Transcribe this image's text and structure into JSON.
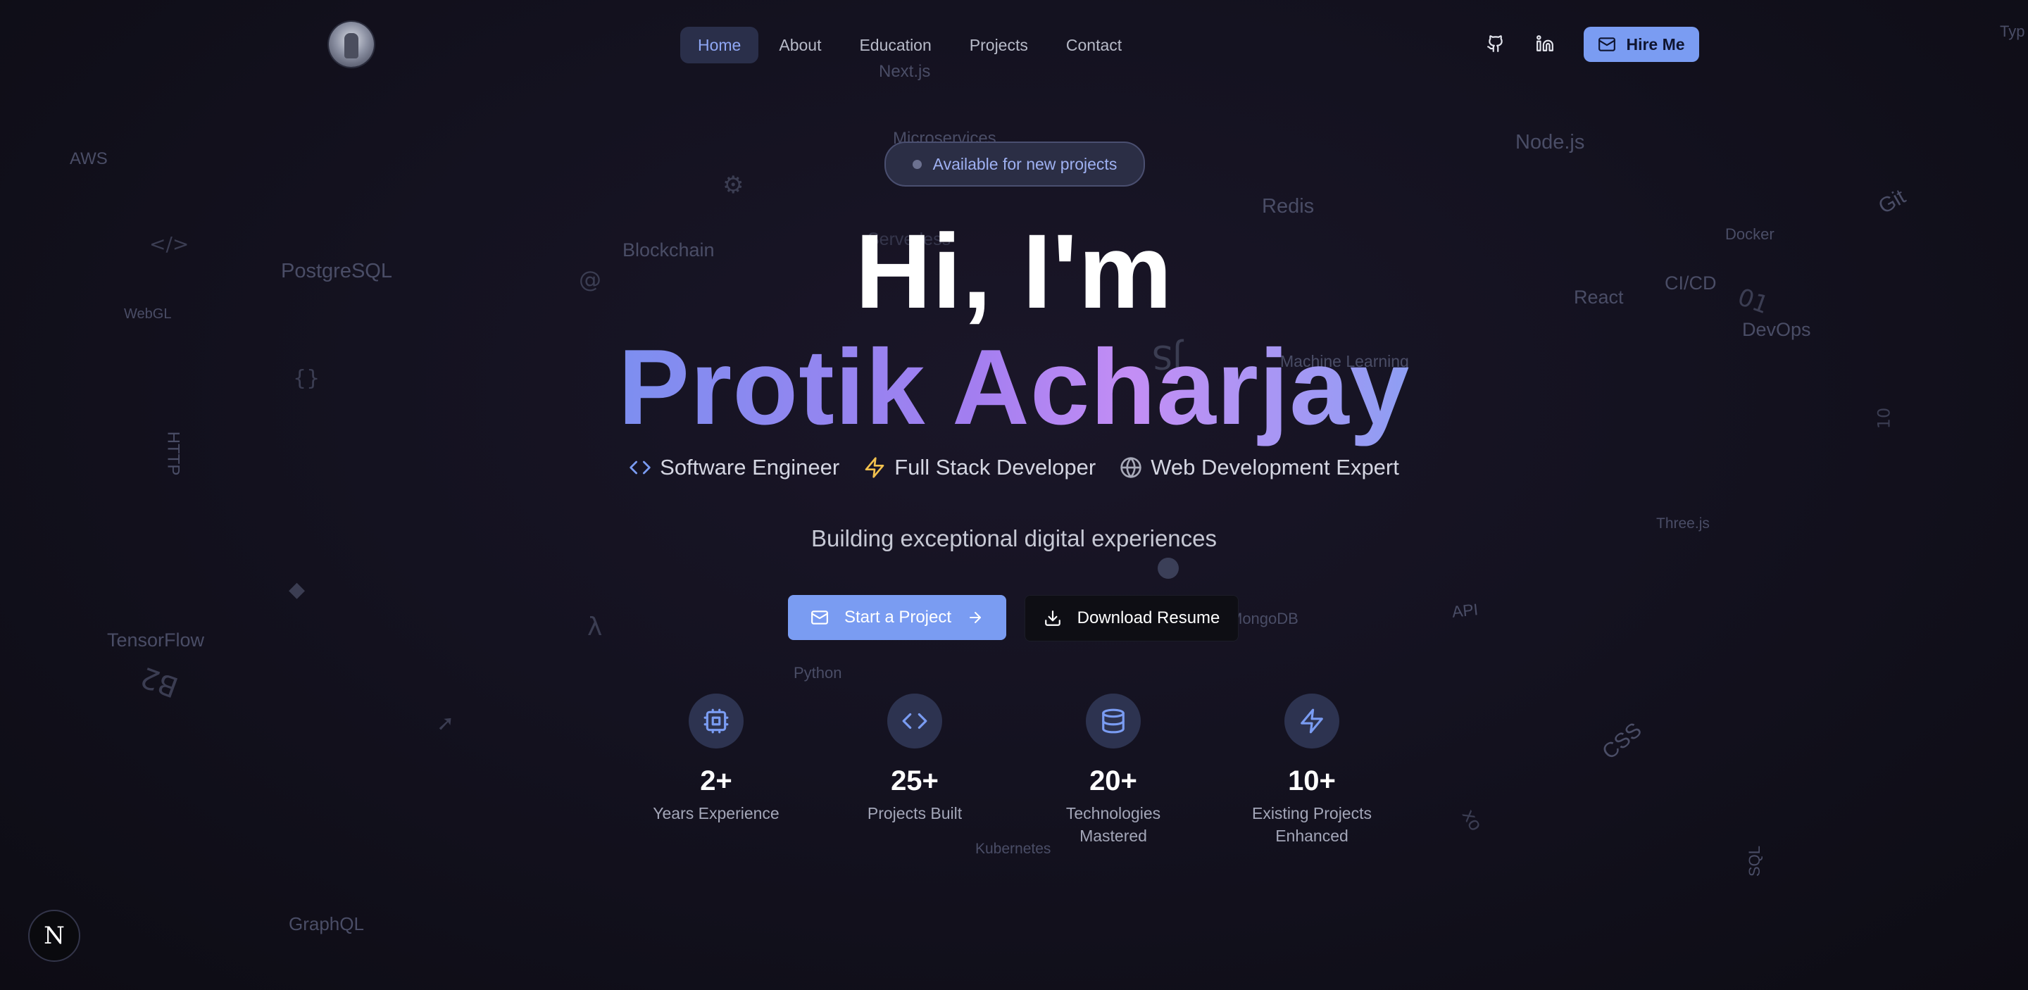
{
  "nav": {
    "items": [
      {
        "label": "Home",
        "active": true
      },
      {
        "label": "About"
      },
      {
        "label": "Education"
      },
      {
        "label": "Projects"
      },
      {
        "label": "Contact"
      }
    ],
    "github_icon": "github-icon",
    "linkedin_icon": "linkedin-icon",
    "hire_label": "Hire Me",
    "hire_icon": "mail-icon"
  },
  "hero": {
    "badge": "Available for new projects",
    "greeting": "Hi, I'm",
    "name": "Protik Acharjay",
    "roles": [
      {
        "label": "Software Engineer",
        "icon": "code-icon"
      },
      {
        "label": "Full Stack Developer",
        "icon": "bolt-icon"
      },
      {
        "label": "Web Development Expert",
        "icon": "globe-icon"
      }
    ],
    "tagline": "Building exceptional digital experiences",
    "primary_cta": "Start a Project",
    "secondary_cta": "Download Resume"
  },
  "stats": [
    {
      "value": "2+",
      "label": "Years Experience",
      "icon": "chip-icon"
    },
    {
      "value": "25+",
      "label": "Projects Built",
      "icon": "code-icon"
    },
    {
      "value": "20+",
      "label": "Technologies Mastered",
      "icon": "database-icon"
    },
    {
      "value": "10+",
      "label": "Existing Projects Enhanced",
      "icon": "bolt-icon"
    }
  ],
  "background_words": [
    "Next.js",
    "Microservices",
    "AWS",
    "Node.js",
    "Redis",
    "Docker",
    "Blockchain",
    "PostgreSQL",
    "CI/CD",
    "React",
    "DevOps",
    "WebGL",
    "Machine Learning",
    "Serverless",
    "Three.js",
    "MongoDB",
    "API",
    "TensorFlow",
    "Python",
    "CSS",
    "Kubernetes",
    "SQL",
    "GraphQL",
    "HTTP",
    "Git",
    "Typ"
  ],
  "framework_badge": "N",
  "colors": {
    "accent": "#7a9cf2",
    "gradient_start": "#7d8ff0",
    "gradient_mid": "#c38ef5",
    "background": "#141220"
  }
}
